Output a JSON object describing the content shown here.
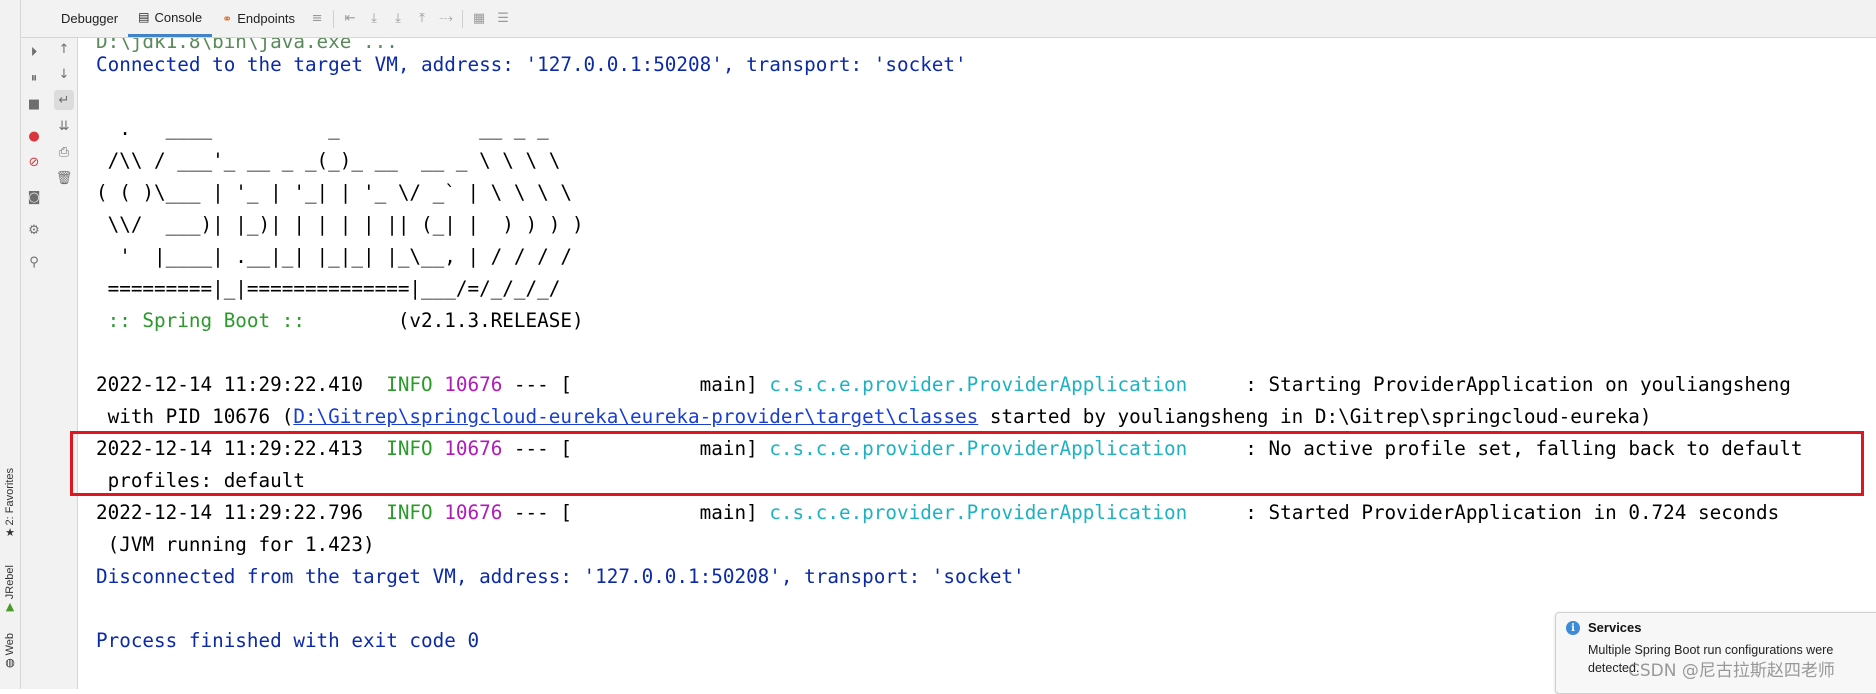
{
  "tabs": [
    {
      "label": "Debugger",
      "icon": "debugger-icon"
    },
    {
      "label": "Console",
      "icon": "console-icon"
    },
    {
      "label": "Endpoints",
      "icon": "endpoints-icon"
    }
  ],
  "side_tabs": {
    "favorites": "2: Favorites",
    "jrebel": "JRebel",
    "web": "Web"
  },
  "console": {
    "cut_first_line": "D:\\jdk1.8\\bin\\java.exe ...",
    "connected": "Connected to the target VM, address: '127.0.0.1:50208', transport: 'socket'",
    "banner": [
      "  .   ____          _            __ _ _",
      " /\\\\ / ___'_ __ _ _(_)_ __  __ _ \\ \\ \\ \\",
      "( ( )\\___ | '_ | '_| | '_ \\/ _` | \\ \\ \\ \\",
      " \\\\/  ___)| |_)| | | | | || (_| |  ) ) ) )",
      "  '  |____| .__|_| |_|_| |_\\__, | / / / /",
      " =========|_|==============|___/=/_/_/_/"
    ],
    "spring_label": " :: Spring Boot :: ",
    "spring_version": "       (v2.1.3.RELEASE)",
    "log1": {
      "timestamp": "2022-12-14 11:29:22.410  ",
      "level": "INFO",
      "pid": " 10676",
      "sep": " --- [           main] ",
      "logger": "c.s.c.e.provider.ProviderApplication",
      "message": "     : Starting ProviderApplication on youliangsheng",
      "cont_prefix": " with PID 10676 (",
      "cont_link": "D:\\Gitrep\\springcloud-eureka\\eureka-provider\\target\\classes",
      "cont_suffix": " started by youliangsheng in D:\\Gitrep\\springcloud-eureka)"
    },
    "log2": {
      "timestamp": "2022-12-14 11:29:22.413  ",
      "level": "INFO",
      "pid": " 10676",
      "sep": " --- [           main] ",
      "logger": "c.s.c.e.provider.ProviderApplication",
      "message": "     : No active profile set, falling back to default",
      "cont": " profiles: default"
    },
    "log3": {
      "timestamp": "2022-12-14 11:29:22.796  ",
      "level": "INFO",
      "pid": " 10676",
      "sep": " --- [           main] ",
      "logger": "c.s.c.e.provider.ProviderApplication",
      "message": "     : Started ProviderApplication in 0.724 seconds",
      "cont": " (JVM running for 1.423)"
    },
    "disconnected": "Disconnected from the target VM, address: '127.0.0.1:50208', transport: 'socket'",
    "exit": "Process finished with exit code 0"
  },
  "notification": {
    "title": "Services",
    "body": "Multiple Spring Boot run configurations were detected."
  },
  "watermark": "CSDN @尼古拉斯赵四老师",
  "colors": {
    "console_blue": "#0b2aa8",
    "info_green": "#2a9a2a",
    "pid_magenta": "#b01bb8",
    "logger_cyan": "#1cb2c4",
    "highlight_red": "#e0161f"
  }
}
